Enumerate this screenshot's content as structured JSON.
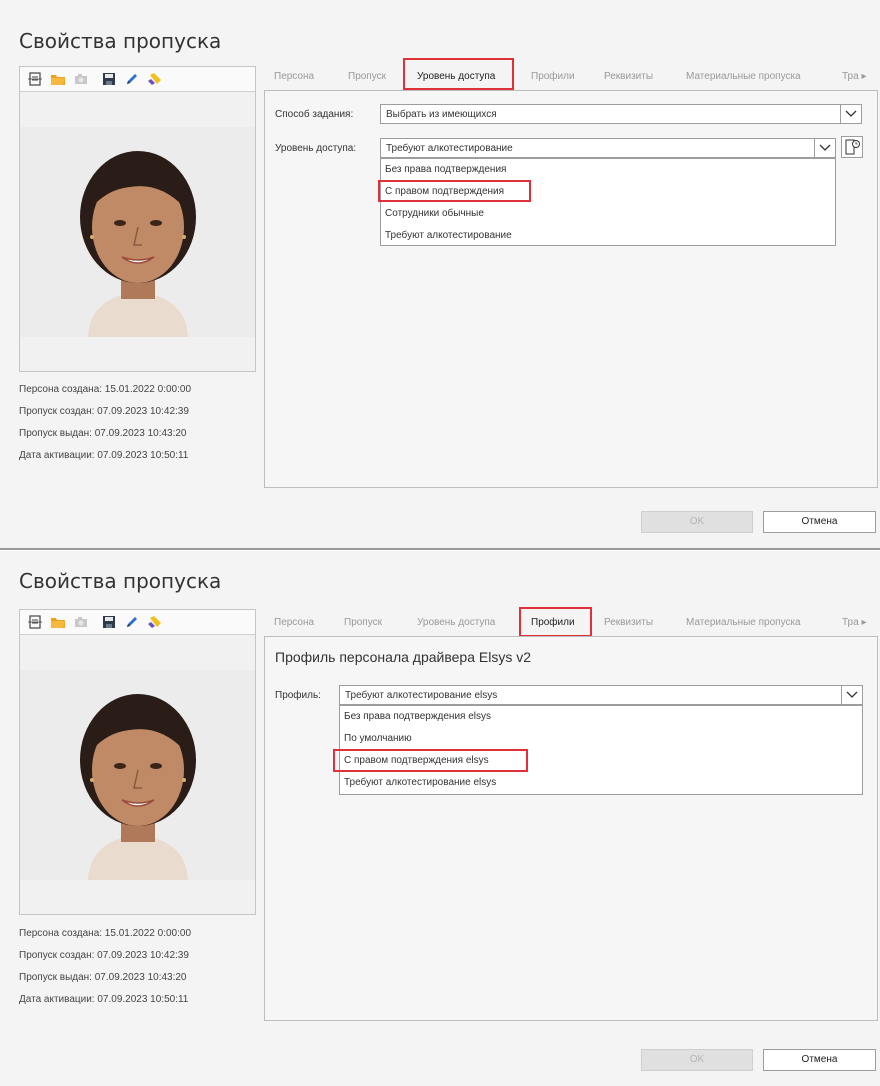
{
  "top": {
    "title": "Свойства пропуска",
    "tabs": [
      "Персона",
      "Пропуск",
      "Уровень доступа",
      "Профили",
      "Реквизиты",
      "Материальные пропуска",
      "Тра ▸"
    ],
    "method_label": "Способ задания:",
    "method_value": "Выбрать из имеющихся",
    "access_label": "Уровень доступа:",
    "access_value": "Требуют алкотестирование",
    "options": [
      "Без права подтверждения",
      "С правом подтверждения",
      "Сотрудники обычные",
      "Требуют алкотестирование"
    ],
    "ok_label": "OK",
    "cancel_label": "Отмена"
  },
  "bottom": {
    "title": "Свойства пропуска",
    "tabs": [
      "Персона",
      "Пропуск",
      "Уровень доступа",
      "Профили",
      "Реквизиты",
      "Материальные пропуска",
      "Тра ▸"
    ],
    "profile_heading": "Профиль персонала драйвера Elsys v2",
    "profile_label": "Профиль:",
    "profile_value": "Требуют алкотестирование elsys",
    "options": [
      "Без права подтверждения elsys",
      "По умолчанию",
      "С правом подтверждения elsys",
      "Требуют алкотестирование elsys"
    ],
    "ok_label": "OK",
    "cancel_label": "Отмена"
  },
  "meta": {
    "person_created": "Персона создана: 15.01.2022 0:00:00",
    "pass_created": "Пропуск создан:   07.09.2023 10:42:39",
    "pass_issued": "Пропуск выдан:    07.09.2023 10:43:20",
    "activation": "Дата активации:   07.09.2023 10:50:11"
  },
  "icons": [
    "scan-icon",
    "folder-icon",
    "camera-icon",
    "save-icon",
    "pen-icon",
    "eraser-icon",
    "chevron-down-icon",
    "card-clock-icon"
  ],
  "colors": {
    "highlight": "#e0303a",
    "folder": "#f0a020"
  }
}
